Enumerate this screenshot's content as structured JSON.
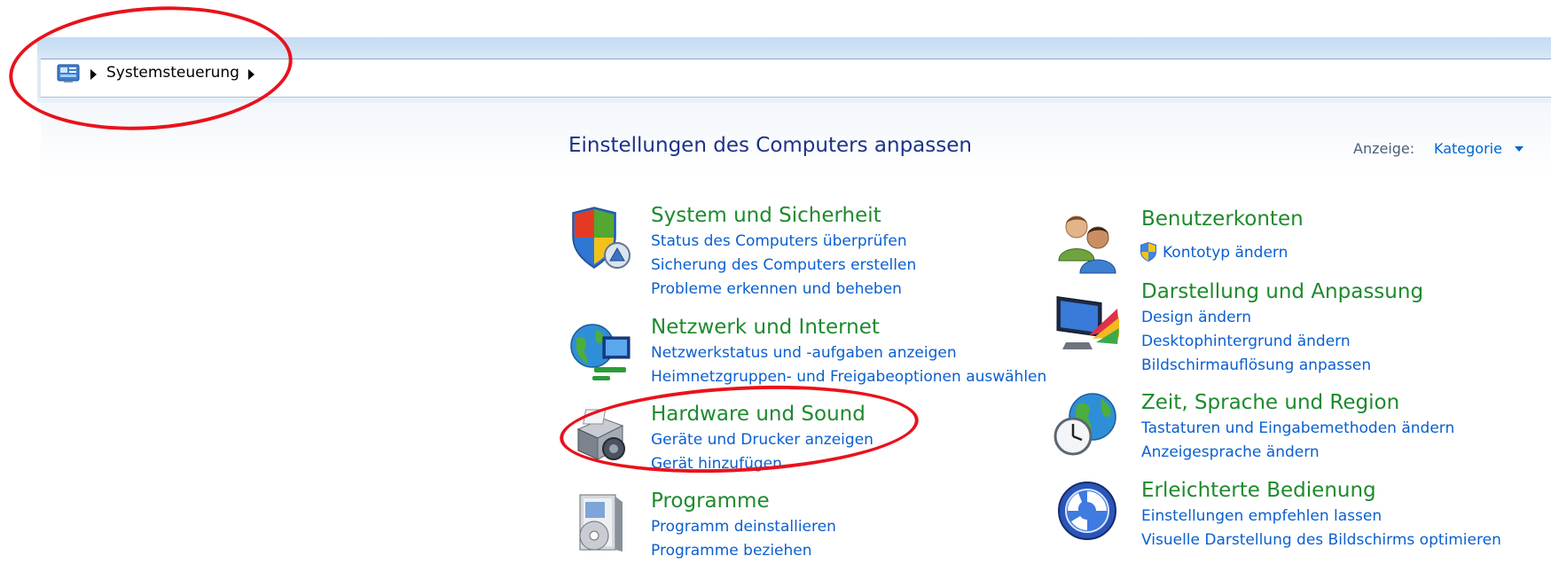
{
  "address_bar": {
    "breadcrumb": "Systemsteuerung",
    "icon": "control-panel-icon"
  },
  "header": {
    "title": "Einstellungen des Computers anpassen",
    "view_label": "Anzeige:",
    "view_value": "Kategorie"
  },
  "categories": {
    "system": {
      "title": "System und Sicherheit",
      "icon": "shield-icon",
      "links": [
        "Status des Computers überprüfen",
        "Sicherung des Computers erstellen",
        "Probleme erkennen und beheben"
      ]
    },
    "network": {
      "title": "Netzwerk und Internet",
      "icon": "network-globe-icon",
      "links": [
        "Netzwerkstatus und -aufgaben anzeigen",
        "Heimnetzgruppen- und Freigabeoptionen auswählen"
      ]
    },
    "hardware": {
      "title": "Hardware und Sound",
      "icon": "printer-speaker-icon",
      "links": [
        "Geräte und Drucker anzeigen",
        "Gerät hinzufügen"
      ]
    },
    "programs": {
      "title": "Programme",
      "icon": "programs-disc-icon",
      "links": [
        "Programm deinstallieren",
        "Programme beziehen"
      ]
    },
    "accounts": {
      "title": "Benutzerkonten",
      "icon": "users-icon",
      "links": [
        "Kontotyp ändern"
      ]
    },
    "appearance": {
      "title": "Darstellung und Anpassung",
      "icon": "monitor-palette-icon",
      "links": [
        "Design ändern",
        "Desktophintergrund ändern",
        "Bildschirmauflösung anpassen"
      ]
    },
    "clock": {
      "title": "Zeit, Sprache und Region",
      "icon": "globe-clock-icon",
      "links": [
        "Tastaturen und Eingabemethoden ändern",
        "Anzeigesprache ändern"
      ]
    },
    "ease": {
      "title": "Erleichterte Bedienung",
      "icon": "ease-of-access-icon",
      "links": [
        "Einstellungen empfehlen lassen",
        "Visuelle Darstellung des Bildschirms optimieren"
      ]
    }
  },
  "colors": {
    "category_title": "#1e8a2d",
    "link": "#0a5fd0",
    "page_title": "#1e3287",
    "annotation": "#e8121c"
  }
}
